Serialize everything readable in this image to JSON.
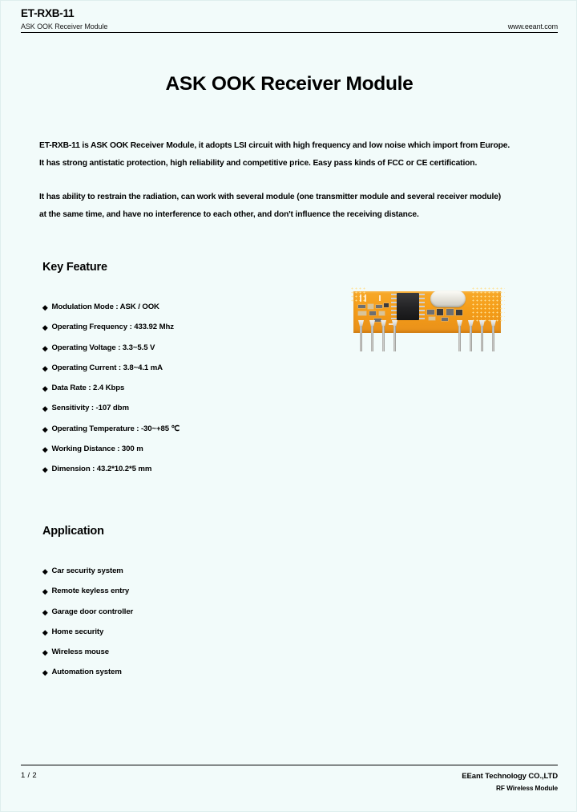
{
  "header": {
    "part_number": "ET-RXB-11",
    "subtitle": "ASK OOK Receiver Module",
    "url": "www.eeant.com"
  },
  "doc_title": "ASK OOK Receiver Module",
  "intro": {
    "paragraph1": [
      "ET-RXB-11 is ASK OOK Receiver Module, it adopts LSI circuit with high frequency and low noise which import from Europe.",
      "It has strong antistatic protection, high reliability and competitive price. Easy pass kinds of FCC or CE certification."
    ],
    "paragraph2": [
      "It has ability to restrain the radiation, can work with several module (one transmitter module and several receiver  module)",
      "at the same time, and have no interference to each other, and don't influence the receiving distance."
    ]
  },
  "key_feature": {
    "heading": "Key Feature",
    "bullet_glyph": "◆",
    "items": [
      "Modulation Mode : ASK / OOK",
      "Operating Frequency : 433.92 Mhz",
      "Operating Voltage : 3.3~5.5 V",
      "Operating Current : 3.8~4.1 mA",
      "Data Rate : 2.4 Kbps",
      "Sensitivity : -107 dbm",
      "Operating Temperature : -30~+85 ℃",
      "Working Distance : 300 m",
      "Dimension : 43.2*10.2*5 mm"
    ]
  },
  "application": {
    "heading": "Application",
    "bullet_glyph": "◆",
    "items": [
      "Car security system",
      "Remote keyless entry",
      "Garage door controller",
      "Home security",
      "Wireless mouse",
      "Automation system"
    ]
  },
  "product_photo": {
    "alt": "ET-RXB-11 receiver module photo",
    "pcb_color": "#f59d18",
    "ic_color": "#232325",
    "crystal_color": "#e6e4dc",
    "pin_color": "#c9c9c5"
  },
  "footer": {
    "page": "1 / 2",
    "company": "EEant Technology CO.,LTD",
    "tagline": "RF Wireless Module"
  }
}
